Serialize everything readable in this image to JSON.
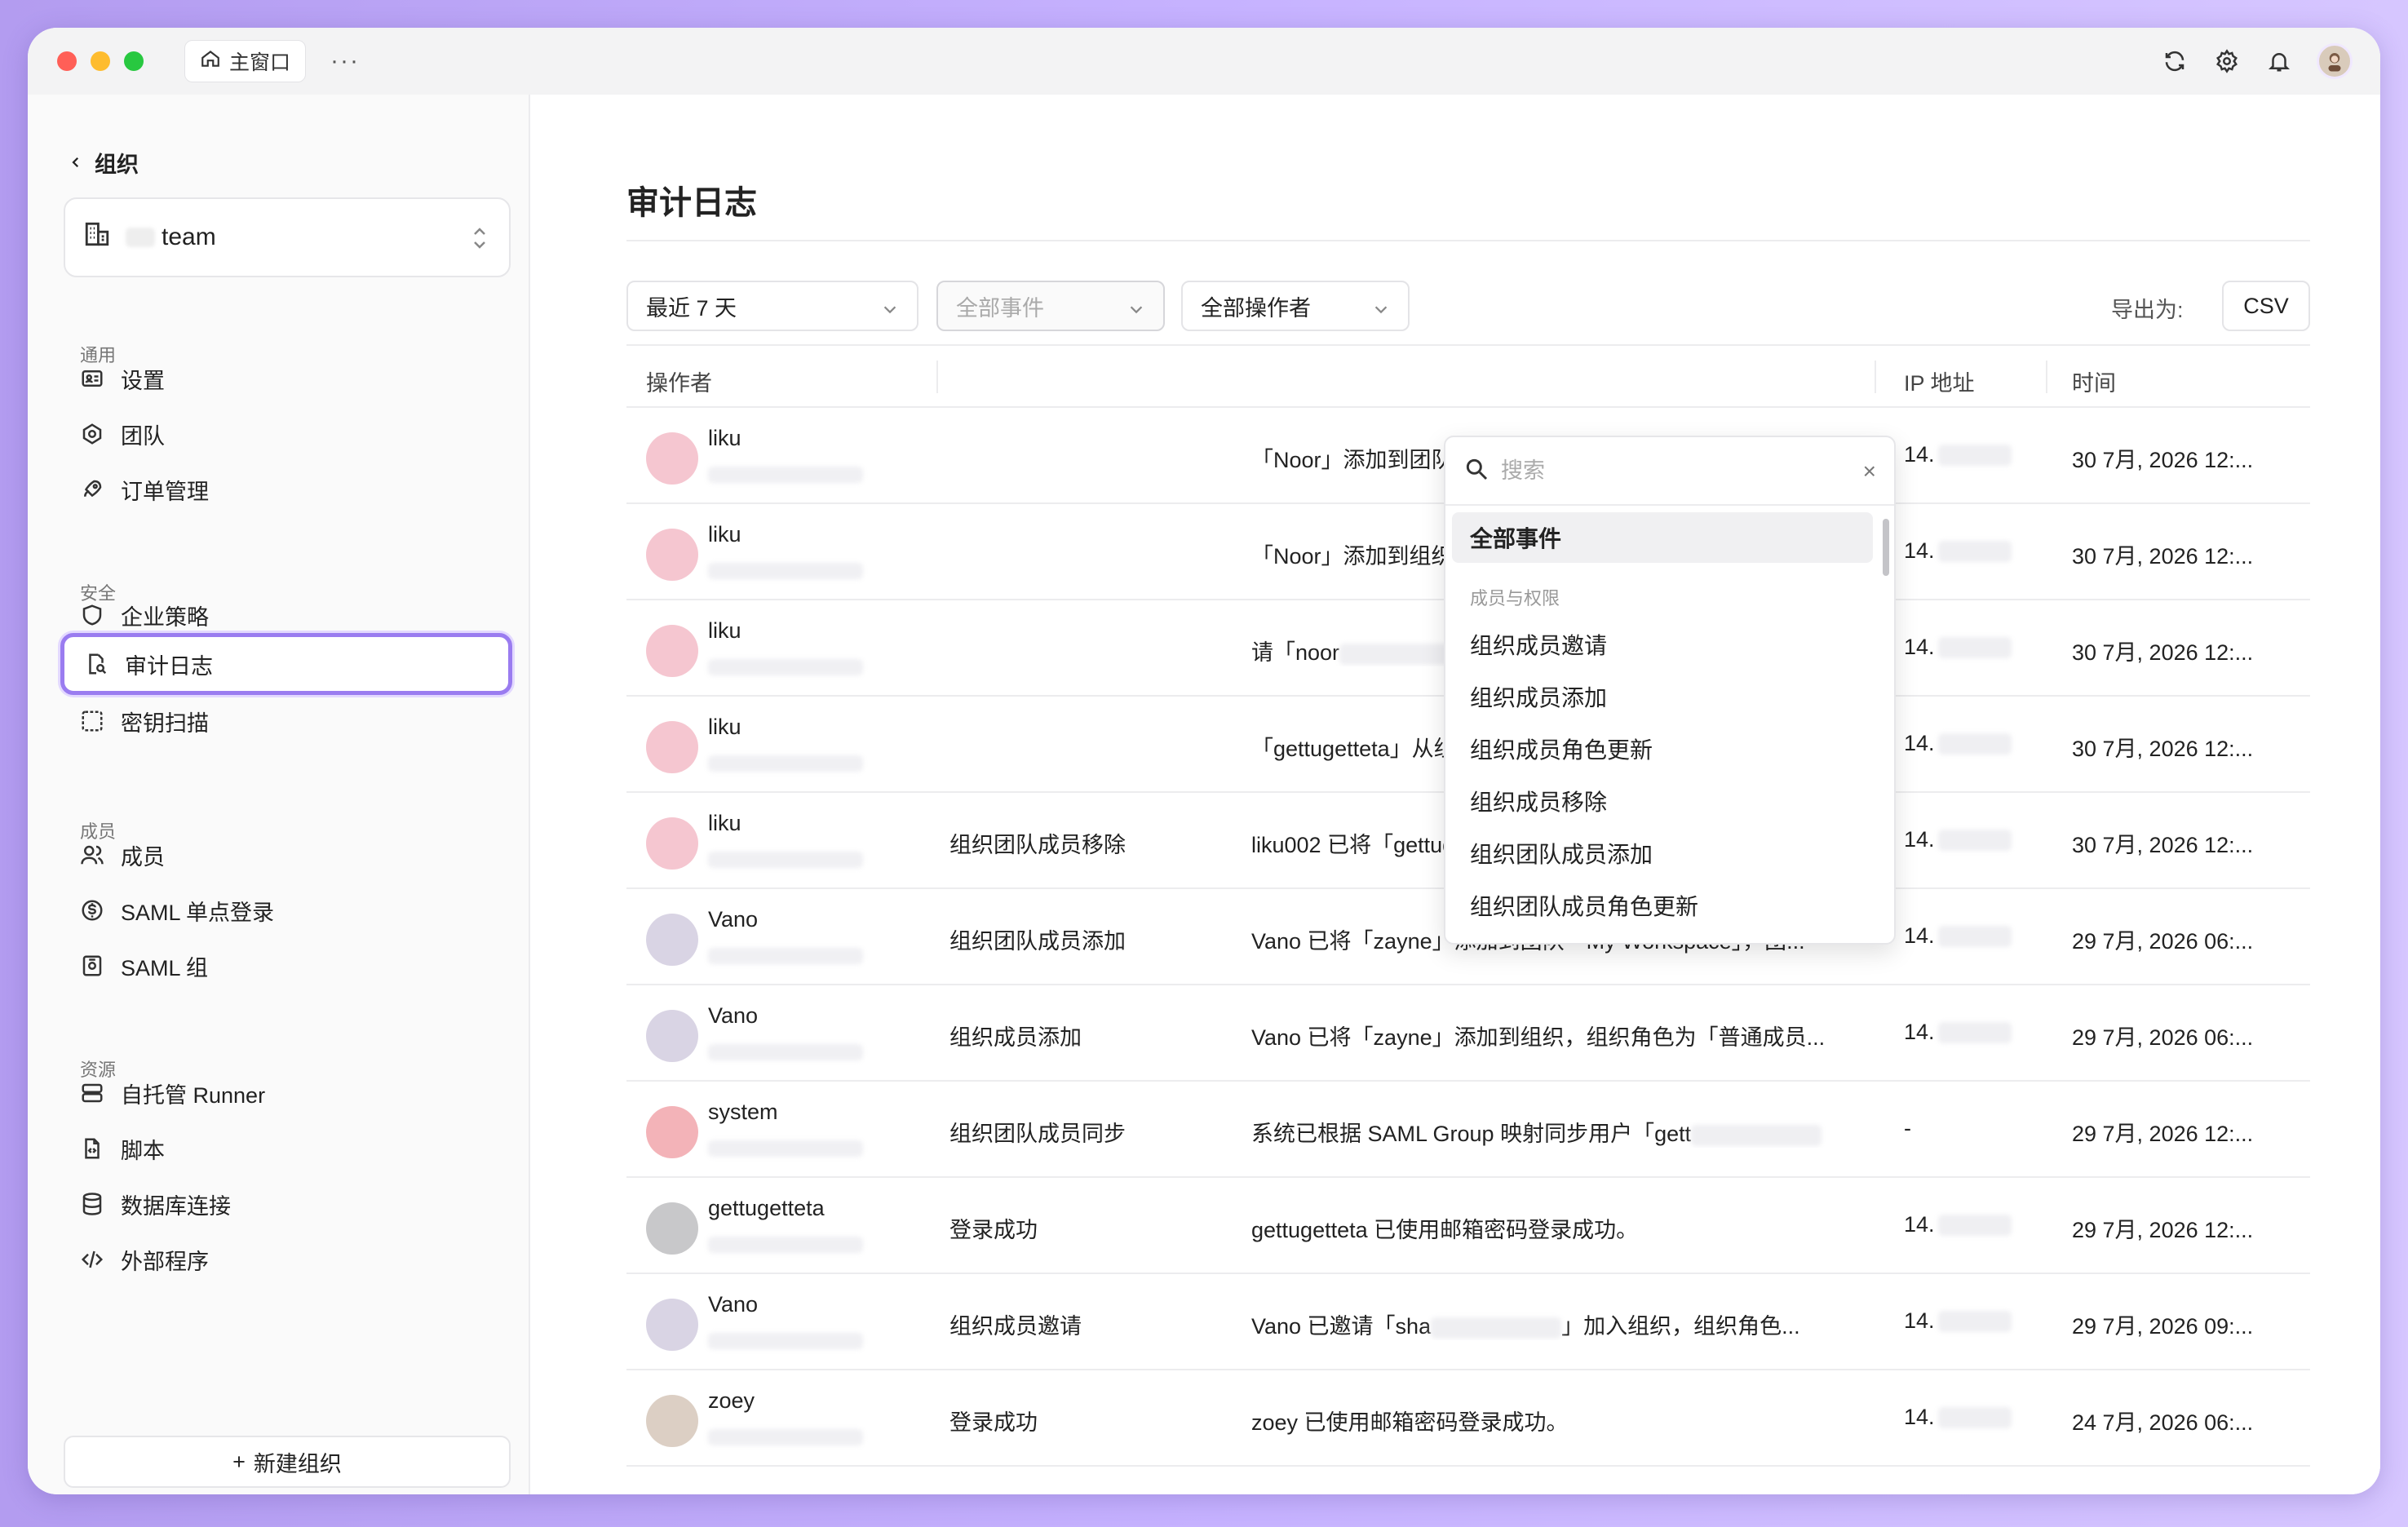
{
  "titlebar": {
    "home_tab": "主窗口",
    "more": "···"
  },
  "sidebar": {
    "back_label": "组织",
    "team_name": "team",
    "sections": {
      "general": "通用",
      "security": "安全",
      "members": "成员",
      "resources": "资源"
    },
    "items": [
      {
        "label": "设置",
        "icon": "id-card-icon"
      },
      {
        "label": "团队",
        "icon": "team-icon"
      },
      {
        "label": "订单管理",
        "icon": "rocket-icon"
      },
      {
        "label": "企业策略",
        "icon": "shield-icon"
      },
      {
        "label": "审计日志",
        "icon": "audit-log-icon"
      },
      {
        "label": "密钥扫描",
        "icon": "scan-icon"
      },
      {
        "label": "成员",
        "icon": "users-icon"
      },
      {
        "label": "SAML 单点登录",
        "icon": "dollar-circle-icon"
      },
      {
        "label": "SAML 组",
        "icon": "saml-group-icon"
      },
      {
        "label": "自托管 Runner",
        "icon": "server-icon"
      },
      {
        "label": "脚本",
        "icon": "script-icon"
      },
      {
        "label": "数据库连接",
        "icon": "database-icon"
      },
      {
        "label": "外部程序",
        "icon": "code-icon"
      }
    ],
    "new_org": "新建组织"
  },
  "main": {
    "title": "审计日志",
    "filters": {
      "range": "最近 7 天",
      "events": "全部事件",
      "operators": "全部操作者"
    },
    "export_label": "导出为:",
    "export_csv": "CSV",
    "columns": {
      "operator": "操作者",
      "ip": "IP 地址",
      "time": "时间"
    },
    "rows": [
      {
        "name": "liku",
        "event": "",
        "desc": "「Noor」添加到团队「My Workspace」，团...",
        "ip": "14.",
        "time": "30 7月, 2026 12:...",
        "avatar": "#f5c6d0"
      },
      {
        "name": "liku",
        "event": "",
        "desc": "「Noor」添加到组织，组织角色为「管理员...",
        "ip": "14.",
        "time": "30 7月, 2026 12:...",
        "avatar": "#f5c6d0"
      },
      {
        "name": "liku",
        "event": "",
        "desc": "请「noor",
        "desc_tail": "」加入组织，组织角色...",
        "ip": "14.",
        "time": "30 7月, 2026 12:...",
        "avatar": "#f5c6d0"
      },
      {
        "name": "liku",
        "event": "",
        "desc": "「gettugetteta」从组织中移除。",
        "ip": "14.",
        "time": "30 7月, 2026 12:...",
        "avatar": "#f5c6d0"
      },
      {
        "name": "liku",
        "event": "组织团队成员移除",
        "desc": "liku002 已将「gettugetteta」从团队「My Workspace」...",
        "ip": "14.",
        "time": "30 7月, 2026 12:...",
        "avatar": "#f5c6d0"
      },
      {
        "name": "Vano",
        "event": "组织团队成员添加",
        "desc": "Vano 已将「zayne」添加到团队「My Workspace」，团...",
        "ip": "14.",
        "time": "29 7月, 2026 06:...",
        "avatar": "#d9d4e4"
      },
      {
        "name": "Vano",
        "event": "组织成员添加",
        "desc": "Vano 已将「zayne」添加到组织，组织角色为「普通成员...",
        "ip": "14.",
        "time": "29 7月, 2026 06:...",
        "avatar": "#d9d4e4"
      },
      {
        "name": "system",
        "event": "组织团队成员同步",
        "desc": "系统已根据 SAML Group 映射同步用户「gett",
        "ip": "-",
        "time": "29 7月, 2026 12:...",
        "avatar": "#f3b3b8"
      },
      {
        "name": "gettugetteta",
        "event": "登录成功",
        "desc": "gettugetteta 已使用邮箱密码登录成功。",
        "ip": "14.",
        "time": "29 7月, 2026 12:...",
        "avatar": "#c8c8ca"
      },
      {
        "name": "Vano",
        "event": "组织成员邀请",
        "desc": "Vano 已邀请「sha",
        "desc_tail": "」加入组织，组织角色...",
        "ip": "14.",
        "time": "29 7月, 2026 09:...",
        "avatar": "#d9d4e4"
      },
      {
        "name": "zoey",
        "event": "登录成功",
        "desc": "zoey 已使用邮箱密码登录成功。",
        "ip": "14.",
        "time": "24 7月, 2026 06:...",
        "avatar": "#dccfc4"
      }
    ]
  },
  "dropdown": {
    "search_placeholder": "搜索",
    "selected": "全部事件",
    "group": "成员与权限",
    "items": [
      "组织成员邀请",
      "组织成员添加",
      "组织成员角色更新",
      "组织成员移除",
      "组织团队成员添加",
      "组织团队成员角色更新"
    ]
  },
  "colors": {
    "accent": "#9a7cf0",
    "background_gradient": "#c6b2ff"
  }
}
